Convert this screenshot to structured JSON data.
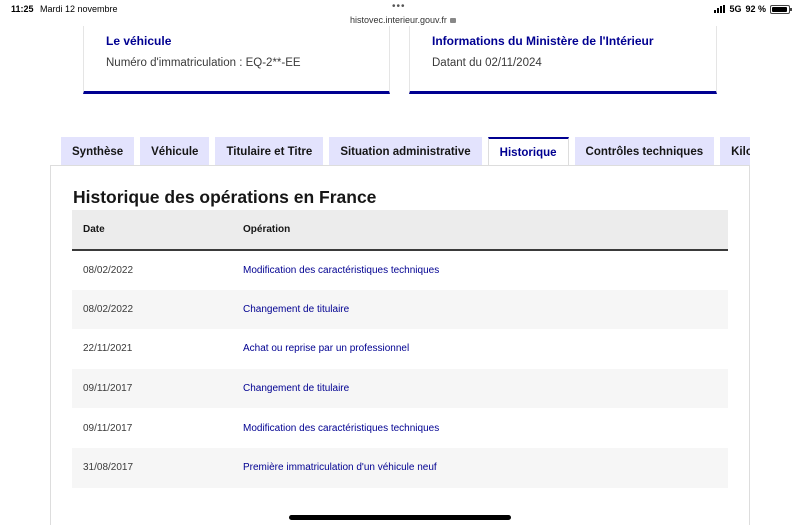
{
  "status_bar": {
    "time": "11:25",
    "date": "Mardi 12 novembre",
    "url": "histovec.interieur.gouv.fr",
    "network": "5G",
    "battery": "92 %"
  },
  "cards": {
    "vehicle": {
      "title": "Le véhicule",
      "subtitle": "Numéro d'immatriculation : EQ-2**-EE"
    },
    "ministry": {
      "title": "Informations du Ministère de l'Intérieur",
      "subtitle": "Datant du 02/11/2024"
    }
  },
  "tabs": [
    {
      "label": "Synthèse"
    },
    {
      "label": "Véhicule"
    },
    {
      "label": "Titulaire et Titre"
    },
    {
      "label": "Situation administrative"
    },
    {
      "label": "Historique"
    },
    {
      "label": "Contrôles techniques"
    },
    {
      "label": "Kilométrage"
    }
  ],
  "active_tab": "Historique",
  "section": {
    "title": "Historique des opérations en France",
    "columns": {
      "date": "Date",
      "operation": "Opération"
    },
    "rows": [
      {
        "date": "08/02/2022",
        "operation": "Modification des caractéristiques techniques"
      },
      {
        "date": "08/02/2022",
        "operation": "Changement de titulaire"
      },
      {
        "date": "22/11/2021",
        "operation": "Achat ou reprise par un professionnel"
      },
      {
        "date": "09/11/2017",
        "operation": "Changement de titulaire"
      },
      {
        "date": "09/11/2017",
        "operation": "Modification des caractéristiques techniques"
      },
      {
        "date": "31/08/2017",
        "operation": "Première immatriculation d'un véhicule neuf"
      }
    ]
  },
  "colors": {
    "accent": "#000091",
    "tab_bg": "#e3e3fd",
    "header_bg": "#ececec"
  }
}
